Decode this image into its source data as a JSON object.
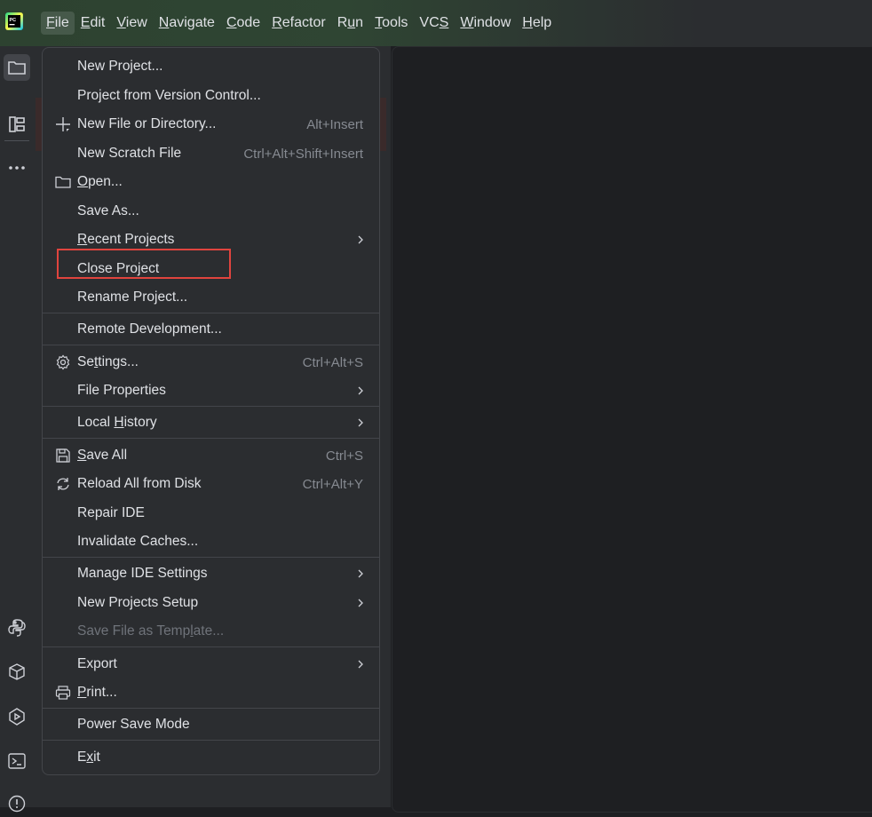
{
  "app": {
    "logo": "pycharm-logo-icon"
  },
  "menubar": [
    {
      "pre": "",
      "u": "F",
      "post": "ile"
    },
    {
      "pre": "",
      "u": "E",
      "post": "dit"
    },
    {
      "pre": "",
      "u": "V",
      "post": "iew"
    },
    {
      "pre": "",
      "u": "N",
      "post": "avigate"
    },
    {
      "pre": "",
      "u": "C",
      "post": "ode"
    },
    {
      "pre": "",
      "u": "R",
      "post": "efactor"
    },
    {
      "pre": "R",
      "u": "u",
      "post": "n"
    },
    {
      "pre": "",
      "u": "T",
      "post": "ools"
    },
    {
      "pre": "VC",
      "u": "S",
      "post": ""
    },
    {
      "pre": "",
      "u": "W",
      "post": "indow"
    },
    {
      "pre": "",
      "u": "H",
      "post": "elp"
    }
  ],
  "file_menu": {
    "items": [
      {
        "pre": "New Project...",
        "u": "",
        "post": "",
        "shortcut": "",
        "submenu": false
      },
      {
        "pre": "Project from Version Control...",
        "u": "",
        "post": "",
        "shortcut": "",
        "submenu": false
      },
      {
        "pre": "New File or Directory...",
        "u": "",
        "post": "",
        "shortcut": "Alt+Insert",
        "submenu": false
      },
      {
        "pre": "New Scratch File",
        "u": "",
        "post": "",
        "shortcut": "Ctrl+Alt+Shift+Insert",
        "submenu": false
      },
      {
        "pre": "",
        "u": "O",
        "post": "pen...",
        "shortcut": "",
        "submenu": false
      },
      {
        "pre": "Save As...",
        "u": "",
        "post": "",
        "shortcut": "",
        "submenu": false
      },
      {
        "pre": "",
        "u": "R",
        "post": "ecent Projects",
        "shortcut": "",
        "submenu": true
      },
      {
        "pre": "Close Project",
        "u": "",
        "post": "",
        "shortcut": "",
        "submenu": false
      },
      {
        "pre": "Rename Project...",
        "u": "",
        "post": "",
        "shortcut": "",
        "submenu": false
      },
      {
        "pre": "Remote Development...",
        "u": "",
        "post": "",
        "shortcut": "",
        "submenu": false
      },
      {
        "pre": "Se",
        "u": "t",
        "post": "tings...",
        "shortcut": "Ctrl+Alt+S",
        "submenu": false
      },
      {
        "pre": "File Properties",
        "u": "",
        "post": "",
        "shortcut": "",
        "submenu": true
      },
      {
        "pre": "Local ",
        "u": "H",
        "post": "istory",
        "shortcut": "",
        "submenu": true
      },
      {
        "pre": "",
        "u": "S",
        "post": "ave All",
        "shortcut": "Ctrl+S",
        "submenu": false
      },
      {
        "pre": "Reload All from Disk",
        "u": "",
        "post": "",
        "shortcut": "Ctrl+Alt+Y",
        "submenu": false
      },
      {
        "pre": "Repair IDE",
        "u": "",
        "post": "",
        "shortcut": "",
        "submenu": false
      },
      {
        "pre": "Invalidate Caches...",
        "u": "",
        "post": "",
        "shortcut": "",
        "submenu": false
      },
      {
        "pre": "Manage IDE Settings",
        "u": "",
        "post": "",
        "shortcut": "",
        "submenu": true
      },
      {
        "pre": "New Projects Setup",
        "u": "",
        "post": "",
        "shortcut": "",
        "submenu": true
      },
      {
        "pre": "Save File as Temp",
        "u": "l",
        "post": "ate...",
        "shortcut": "",
        "submenu": false,
        "disabled": true
      },
      {
        "pre": "Export",
        "u": "",
        "post": "",
        "shortcut": "",
        "submenu": true
      },
      {
        "pre": "",
        "u": "P",
        "post": "rint...",
        "shortcut": "",
        "submenu": false
      },
      {
        "pre": "Power Save Mode",
        "u": "",
        "post": "",
        "shortcut": "",
        "submenu": false
      },
      {
        "pre": "E",
        "u": "x",
        "post": "it",
        "shortcut": "",
        "submenu": false
      }
    ]
  },
  "colors": {
    "highlight": "#e0443e",
    "menu_bg": "#2b2d30",
    "titlebar_green": "#2f4533"
  }
}
